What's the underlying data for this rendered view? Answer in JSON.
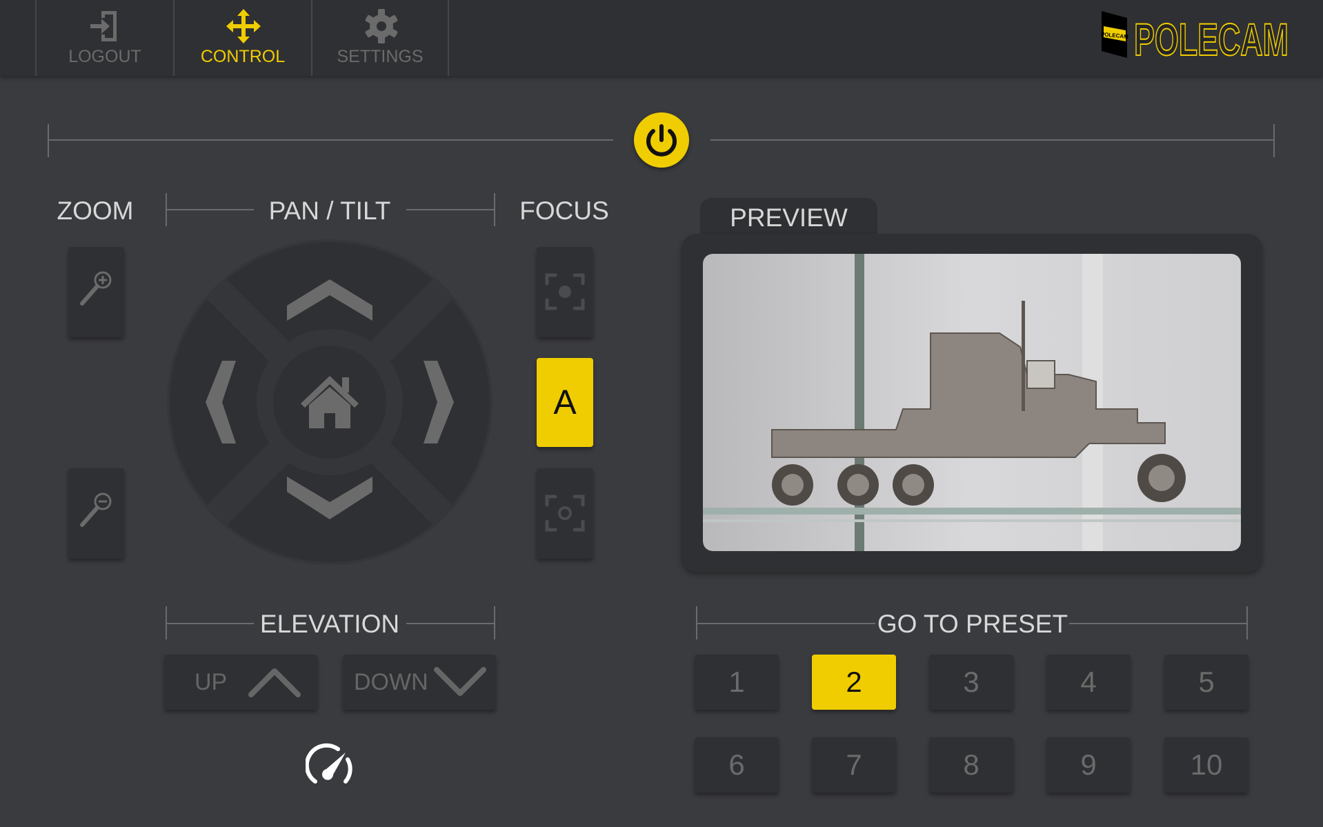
{
  "nav": {
    "tabs": [
      {
        "label": "LOGOUT",
        "icon": "logout-icon",
        "active": false
      },
      {
        "label": "CONTROL",
        "icon": "move-arrows-icon",
        "active": true
      },
      {
        "label": "SETTINGS",
        "icon": "gear-icon",
        "active": false
      }
    ]
  },
  "brand": {
    "logo_text": "POLECAM",
    "accent": "#f0cd00"
  },
  "power": {
    "icon": "power-icon"
  },
  "sections": {
    "zoom": "ZOOM",
    "pan_tilt": "PAN / TILT",
    "focus": "FOCUS",
    "preview": "PREVIEW",
    "elevation": "ELEVATION",
    "presets": "GO TO PRESET"
  },
  "focus": {
    "auto_label": "A"
  },
  "elevation": {
    "up": "UP",
    "down": "DOWN"
  },
  "presets": {
    "items": [
      "1",
      "2",
      "3",
      "4",
      "5",
      "6",
      "7",
      "8",
      "9",
      "10"
    ],
    "active": "2"
  },
  "colors": {
    "bg": "#3a3b3f",
    "header": "#2f3033",
    "button": "#2f3033",
    "accent": "#f0cd00",
    "muted": "#6b6b6b"
  }
}
